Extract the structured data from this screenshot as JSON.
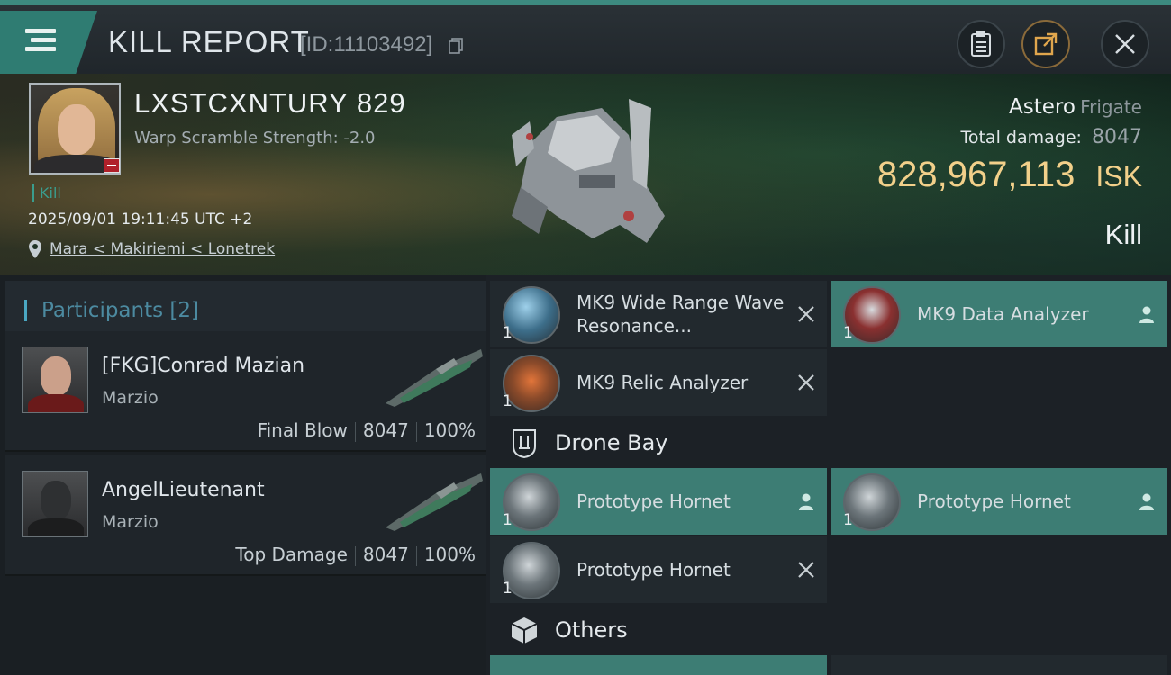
{
  "header": {
    "title": "KILL REPORT",
    "report_id": "[ID:11103492]"
  },
  "victim": {
    "name": "LXSTCXNTURY 829",
    "warp_scramble": "Warp Scramble Strength: -2.0",
    "kill_tag": "Kill",
    "timestamp": "2025/09/01 19:11:45 UTC +2",
    "location": "Mara < Makiriemi < Lonetrek",
    "ship_name": "Astero",
    "ship_class": "Frigate",
    "total_damage_label": "Total damage:",
    "total_damage_value": "8047",
    "isk_value": "828,967,113",
    "isk_currency": "ISK",
    "outcome": "Kill"
  },
  "participants": {
    "title": "Participants",
    "count": "[2]",
    "items": [
      {
        "name": "[FKG]Conrad Mazian",
        "corp": "Marzio",
        "role": "Final Blow",
        "damage": "8047",
        "percent": "100%"
      },
      {
        "name": "AngelLieutenant",
        "corp": "Marzio",
        "role": "Top Damage",
        "damage": "8047",
        "percent": "100%"
      }
    ]
  },
  "fitting": {
    "modules": [
      {
        "name": "MK9 Wide Range Wave Resonance...",
        "qty": "1",
        "status": "destroyed",
        "icon": "scanner-probe-icon"
      },
      {
        "name": "MK9 Data Analyzer",
        "qty": "1",
        "status": "dropped",
        "icon": "data-analyzer-icon"
      },
      {
        "name": "MK9 Relic Analyzer",
        "qty": "1",
        "status": "destroyed",
        "icon": "relic-analyzer-icon"
      }
    ],
    "drone_bay_label": "Drone Bay",
    "drones": [
      {
        "name": "Prototype  Hornet",
        "qty": "1",
        "status": "dropped"
      },
      {
        "name": "Prototype  Hornet",
        "qty": "1",
        "status": "dropped"
      },
      {
        "name": "Prototype  Hornet",
        "qty": "1",
        "status": "destroyed"
      }
    ],
    "others_label": "Others"
  },
  "colors": {
    "accent": "#3d8a80",
    "dropped": "#3d7d74",
    "isk": "#f2d08a",
    "participants_title": "#4c8aa0"
  }
}
